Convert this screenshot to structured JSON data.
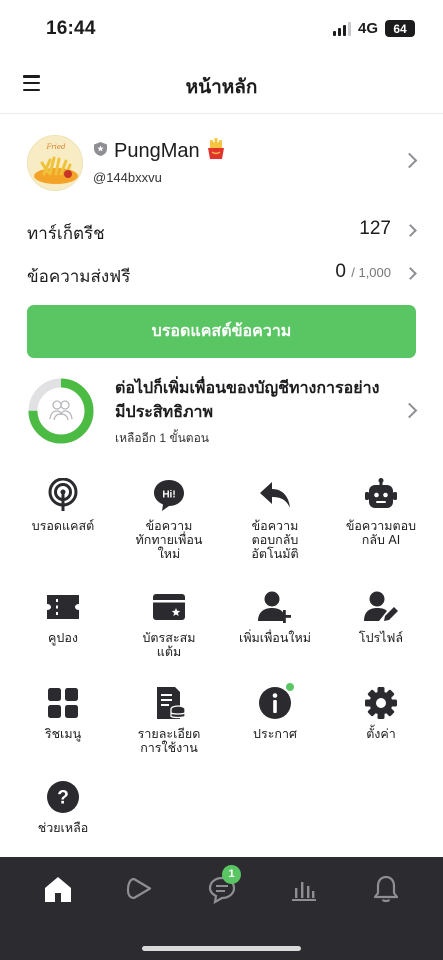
{
  "status_bar": {
    "time": "16:44",
    "network": "4G",
    "battery": "64"
  },
  "header": {
    "title": "หน้าหลัก",
    "menu_icon": "hamburger-menu-icon"
  },
  "profile": {
    "name": "PungMan",
    "name_emoji": "🍟",
    "handle": "@144bxxvu",
    "badge_icon": "shield-icon"
  },
  "stats": {
    "target_reach": {
      "label": "ทาร์เก็ตรีช",
      "value": "127"
    },
    "free_messages": {
      "label": "ข้อความส่งฟรี",
      "value": "0",
      "limit": "/ 1,000"
    }
  },
  "broadcast_button": {
    "label": "บรอดแคสต์ข้อความ"
  },
  "progress": {
    "title": "ต่อไปก็เพิ่มเพื่อนของบัญชีทางการอย่างมีประสิทธิภาพ",
    "subtitle": "เหลืออีก 1 ขั้นตอน",
    "completed_fraction": 0.75
  },
  "grid": [
    {
      "label": "บรอดแคสต์",
      "icon": "broadcast-icon"
    },
    {
      "label": "ข้อความทักทายเพื่อนใหม่",
      "icon": "hi-greeting-icon"
    },
    {
      "label": "ข้อความตอบกลับอัตโนมัติ",
      "icon": "auto-reply-icon"
    },
    {
      "label": "ข้อความตอบกลับ AI",
      "icon": "ai-bot-icon"
    },
    {
      "label": "คูปอง",
      "icon": "coupon-icon"
    },
    {
      "label": "บัตรสะสมแต้ม",
      "icon": "reward-card-icon"
    },
    {
      "label": "เพิ่มเพื่อนใหม่",
      "icon": "add-friend-icon"
    },
    {
      "label": "โปรไฟล์",
      "icon": "profile-edit-icon"
    },
    {
      "label": "ริชเมนู",
      "icon": "rich-menu-icon"
    },
    {
      "label": "รายละเอียดการใช้งาน",
      "icon": "usage-details-icon"
    },
    {
      "label": "ประกาศ",
      "icon": "info-icon"
    },
    {
      "label": "ตั้งค่า",
      "icon": "settings-gear-icon"
    },
    {
      "label": "ช่วยเหลือ",
      "icon": "help-icon"
    }
  ],
  "bottom_nav": {
    "items": [
      "home-icon",
      "voom-play-icon",
      "chat-icon",
      "insights-chart-icon",
      "notifications-bell-icon"
    ],
    "chat_badge": "1"
  },
  "colors": {
    "accent": "#5ac563",
    "nav_bg": "#2c2c30",
    "icon": "#2b2b2f"
  }
}
